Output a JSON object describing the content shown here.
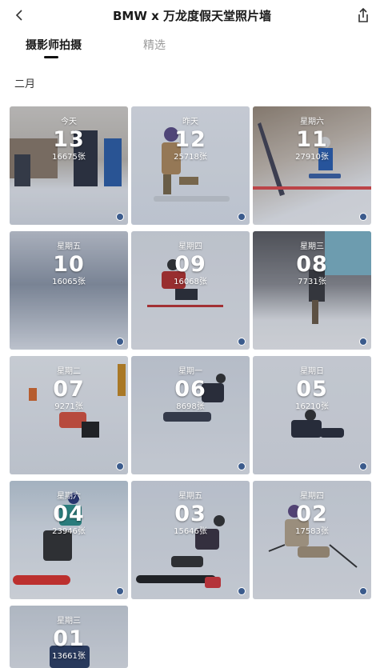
{
  "header": {
    "title": "BMW x 万龙度假天堂照片墙"
  },
  "tabs": [
    {
      "label": "摄影师拍摄"
    },
    {
      "label": "精选"
    }
  ],
  "month": "二月",
  "tiles": [
    {
      "weekday": "今天",
      "date": "13",
      "count": "16675张"
    },
    {
      "weekday": "昨天",
      "date": "12",
      "count": "25718张"
    },
    {
      "weekday": "星期六",
      "date": "11",
      "count": "27910张"
    },
    {
      "weekday": "星期五",
      "date": "10",
      "count": "16065张"
    },
    {
      "weekday": "星期四",
      "date": "09",
      "count": "16068张"
    },
    {
      "weekday": "星期三",
      "date": "08",
      "count": "7731张"
    },
    {
      "weekday": "星期二",
      "date": "07",
      "count": "9271张"
    },
    {
      "weekday": "星期一",
      "date": "06",
      "count": "8698张"
    },
    {
      "weekday": "星期日",
      "date": "05",
      "count": "16210张"
    },
    {
      "weekday": "星期六",
      "date": "04",
      "count": "23946张"
    },
    {
      "weekday": "星期五",
      "date": "03",
      "count": "15646张"
    },
    {
      "weekday": "星期四",
      "date": "02",
      "count": "17583张"
    },
    {
      "weekday": "星期三",
      "date": "01",
      "count": "13661张"
    }
  ]
}
